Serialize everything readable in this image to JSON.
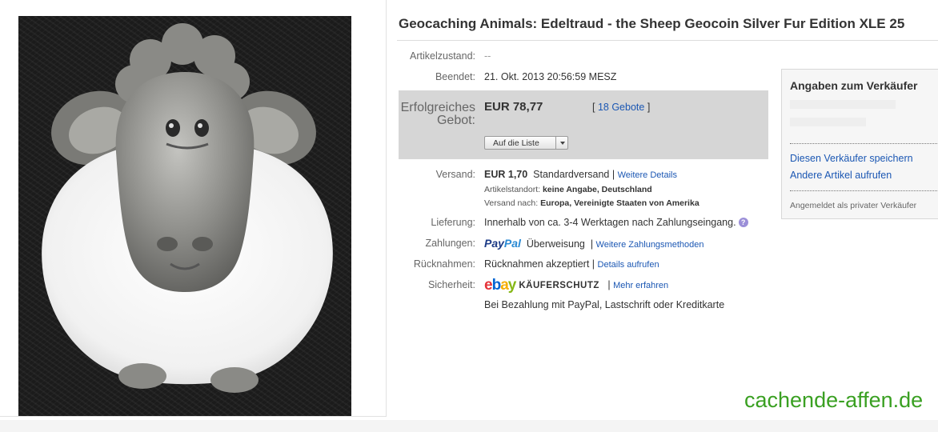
{
  "listing": {
    "title": "Geocaching Animals: Edeltraud - the Sheep Geocoin Silver Fur Edition XLE 25"
  },
  "details": {
    "condition_label": "Artikelzustand:",
    "condition_value": "--",
    "ended_label": "Beendet:",
    "ended_value": "21. Okt. 2013  20:56:59 MESZ"
  },
  "bid": {
    "label_line1": "Erfolgreiches",
    "label_line2": "Gebot:",
    "price": "EUR 78,77",
    "bids_open": "[ ",
    "bids_link": "18 Gebote",
    "bids_close": " ]",
    "watch_button": "Auf die Liste"
  },
  "shipping": {
    "label": "Versand:",
    "price": "EUR 1,70",
    "method": "Standardversand |",
    "more_link": "Weitere Details",
    "location_label": "Artikelstandort:",
    "location_value": "keine Angabe, Deutschland",
    "ships_to_label": "Versand nach:",
    "ships_to_value": "Europa, Vereinigte Staaten von Amerika"
  },
  "delivery": {
    "label": "Lieferung:",
    "value": "Innerhalb von ca. 3-4 Werktagen nach Zahlungseingang.",
    "help_glyph": "?"
  },
  "payment": {
    "label": "Zahlungen:",
    "paypal_part1": "Pay",
    "paypal_part2": "Pal",
    "method": "Überweisung",
    "sep": "|",
    "more_link": "Weitere Zahlungsmethoden"
  },
  "returns": {
    "label": "Rücknahmen:",
    "value": "Rücknahmen akzeptiert |",
    "link": "Details aufrufen"
  },
  "security": {
    "label": "Sicherheit:",
    "ebay_e": "e",
    "ebay_b": "b",
    "ebay_a": "a",
    "ebay_y": "y",
    "kaeuferschutz": "KÄUFERSCHUTZ",
    "sep": "|",
    "more_link": "Mehr erfahren",
    "note": "Bei Bezahlung mit PayPal, Lastschrift oder Kreditkarte"
  },
  "seller": {
    "title": "Angaben zum Verkäufer",
    "save_link": "Diesen Verkäufer speichern",
    "other_items_link": "Andere Artikel aufrufen",
    "registered": "Angemeldet als privater Verkäufer"
  },
  "watermark": "cachende-affen.de",
  "colors": {
    "link": "#1b57b3",
    "bid_box": "#d6d6d6",
    "watermark": "#3aa022"
  }
}
